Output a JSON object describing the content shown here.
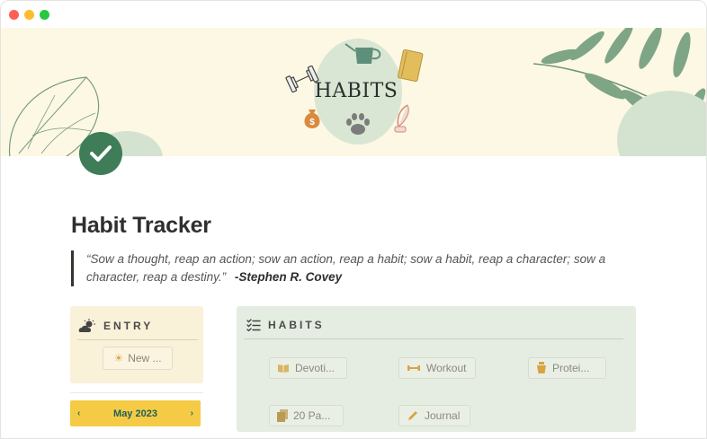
{
  "window": {
    "traffic_lights": [
      "close",
      "minimize",
      "zoom"
    ]
  },
  "cover": {
    "title": "HABITS",
    "decorations": [
      "dumbbell-icon",
      "watering-can-icon",
      "book-icon",
      "money-bag-icon",
      "paw-icon",
      "quill-icon",
      "leaf-branch",
      "monstera-leaf"
    ]
  },
  "page": {
    "icon": "checkmark-icon",
    "title": "Habit Tracker",
    "quote": {
      "text": "“Sow a thought, reap an action; sow an action, reap a habit; sow a habit, reap a character; sow a character, reap a destiny.”",
      "author": "-Stephen R. Covey"
    }
  },
  "entry": {
    "header": "ENTRY",
    "icon": "sun-cloud-icon",
    "new_button": "New ...",
    "new_button_icon": "sun-icon"
  },
  "calendar": {
    "month": "May 2023",
    "prev": "‹",
    "next": "›"
  },
  "habits": {
    "header": "HABITS",
    "icon": "checklist-icon",
    "items": [
      {
        "label": "Devoti...",
        "icon": "book-open-icon"
      },
      {
        "label": "Workout",
        "icon": "dumbbell-icon"
      },
      {
        "label": "Protei...",
        "icon": "shaker-icon"
      },
      {
        "label": "20 Pa...",
        "icon": "pages-icon"
      },
      {
        "label": "Journal",
        "icon": "pen-icon"
      }
    ]
  },
  "colors": {
    "cover_bg": "#fdf8e3",
    "accent_green": "#3e7d57",
    "entry_bg": "#faf1d9",
    "habits_bg": "#e5ece1",
    "month_bar": "#f5cb46"
  }
}
